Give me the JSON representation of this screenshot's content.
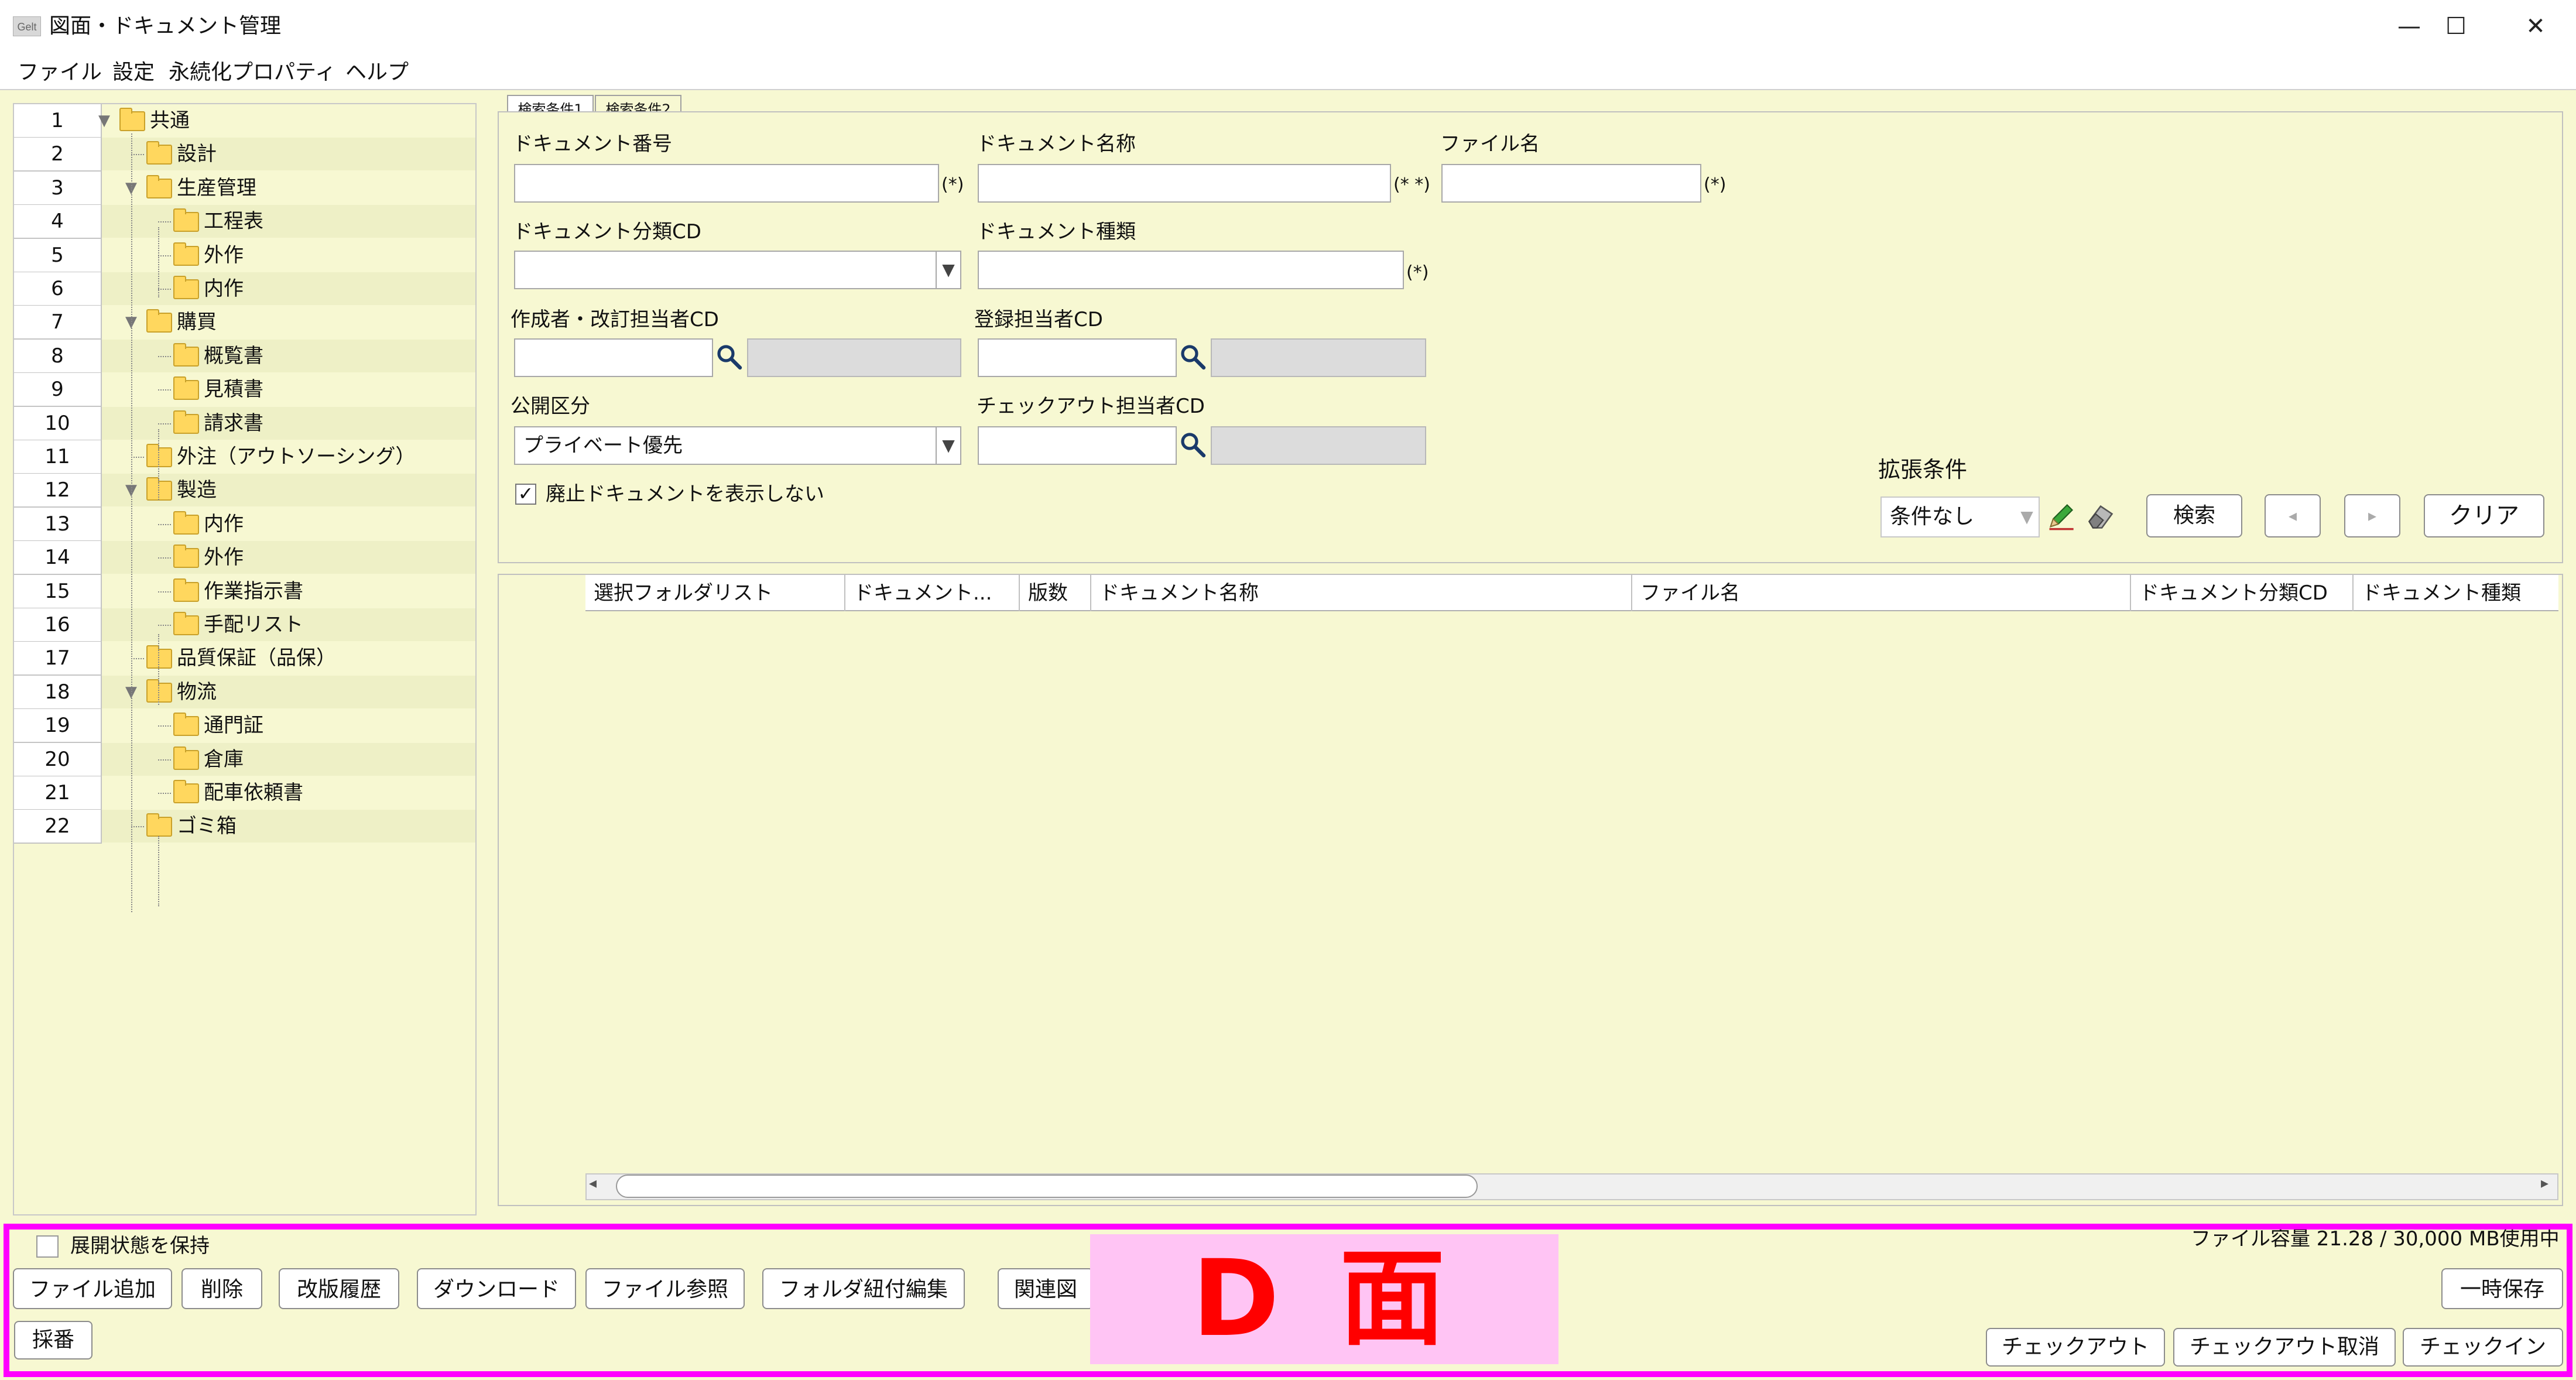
{
  "window": {
    "app_icon": "Gelt",
    "title": "図面・ドキュメント管理",
    "minimize": "—",
    "maximize": "☐",
    "close": "✕"
  },
  "menu": [
    "ファイル",
    "設定",
    "永続化プロパティ",
    "ヘルプ"
  ],
  "tree": [
    {
      "n": "1",
      "label": "共通",
      "depth": 0,
      "expanded": true
    },
    {
      "n": "2",
      "label": "設計",
      "depth": 1
    },
    {
      "n": "3",
      "label": "生産管理",
      "depth": 1,
      "expanded": true
    },
    {
      "n": "4",
      "label": "工程表",
      "depth": 2
    },
    {
      "n": "5",
      "label": "外作",
      "depth": 2
    },
    {
      "n": "6",
      "label": "内作",
      "depth": 2
    },
    {
      "n": "7",
      "label": "購買",
      "depth": 1,
      "expanded": true
    },
    {
      "n": "8",
      "label": "概覧書",
      "depth": 2
    },
    {
      "n": "9",
      "label": "見積書",
      "depth": 2
    },
    {
      "n": "10",
      "label": "請求書",
      "depth": 2
    },
    {
      "n": "11",
      "label": "外注（アウトソーシング）",
      "depth": 1
    },
    {
      "n": "12",
      "label": "製造",
      "depth": 1,
      "expanded": true
    },
    {
      "n": "13",
      "label": "内作",
      "depth": 2
    },
    {
      "n": "14",
      "label": "外作",
      "depth": 2
    },
    {
      "n": "15",
      "label": "作業指示書",
      "depth": 2
    },
    {
      "n": "16",
      "label": "手配リスト",
      "depth": 2
    },
    {
      "n": "17",
      "label": "品質保証（品保）",
      "depth": 1
    },
    {
      "n": "18",
      "label": "物流",
      "depth": 1,
      "expanded": true
    },
    {
      "n": "19",
      "label": "通門証",
      "depth": 2
    },
    {
      "n": "20",
      "label": "倉庫",
      "depth": 2
    },
    {
      "n": "21",
      "label": "配車依頼書",
      "depth": 2
    },
    {
      "n": "22",
      "label": "ゴミ箱",
      "depth": 1
    }
  ],
  "search": {
    "tabs": [
      "検索条件1",
      "検索条件2"
    ],
    "doc_number_label": "ドキュメント番号",
    "doc_number_mark": "(*)",
    "doc_name_label": "ドキュメント名称",
    "doc_name_mark": "(* *)",
    "file_name_label": "ファイル名",
    "file_name_mark": "(*)",
    "doc_class_label": "ドキュメント分類CD",
    "doc_type_label": "ドキュメント種類",
    "doc_type_mark": "(*)",
    "author_label": "作成者・改訂担当者CD",
    "registrar_label": "登録担当者CD",
    "visibility_label": "公開区分",
    "visibility_value": "プライベート優先",
    "checkout_user_label": "チェックアウト担当者CD",
    "hide_obsolete_label": "廃止ドキュメントを表示しない",
    "hide_obsolete_checked": "✓",
    "ext_label": "拡張条件",
    "ext_value": "条件なし",
    "search_button": "検索",
    "prev_button": "◂",
    "next_button": "▸",
    "clear_button": "クリア"
  },
  "table": {
    "columns": [
      "選択フォルダリスト",
      "ドキュメント...",
      "版数",
      "ドキュメント名称",
      "ファイル名",
      "ドキュメント分類CD",
      "ドキュメント種類"
    ],
    "rows": []
  },
  "bottom": {
    "keep_expand_label": "展開状態を保持",
    "file_capacity": "ファイル容量  21.28 / 30,000  MB使用中",
    "buttons_left": [
      "ファイル追加",
      "削除",
      "改版履歴",
      "ダウンロード",
      "ファイル参照",
      "フォルダ紐付編集",
      "関連図"
    ],
    "number_button": "採番",
    "temp_save_button": "一時保存",
    "checkout_button": "チェックアウト",
    "checkout_cancel_button": "チェックアウト取消",
    "checkin_button": "チェックイン",
    "annotation": "D 面"
  },
  "colors": {
    "panel_bg": "#f7f8d2",
    "annotation_frame": "#ff00ff",
    "annotation_fill": "#ffc4f4",
    "annotation_text": "#ff0000"
  },
  "icons": [
    "app-icon",
    "folder-icon",
    "search-lens-icon",
    "pencil-icon",
    "eraser-icon",
    "dropdown-arrow-icon"
  ]
}
